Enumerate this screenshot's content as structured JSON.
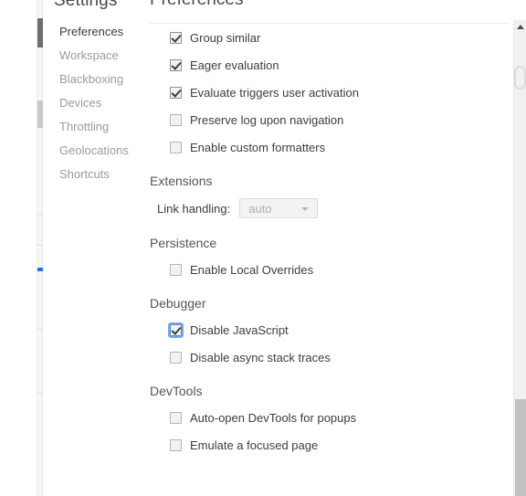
{
  "sidebar": {
    "title": "Settings",
    "items": [
      {
        "label": "Preferences",
        "selected": true
      },
      {
        "label": "Workspace",
        "selected": false
      },
      {
        "label": "Blackboxing",
        "selected": false
      },
      {
        "label": "Devices",
        "selected": false
      },
      {
        "label": "Throttling",
        "selected": false
      },
      {
        "label": "Geolocations",
        "selected": false
      },
      {
        "label": "Shortcuts",
        "selected": false
      }
    ]
  },
  "content": {
    "title": "Preferences",
    "checkboxes_top": [
      {
        "label": "Group similar",
        "checked": true,
        "focused": false
      },
      {
        "label": "Eager evaluation",
        "checked": true,
        "focused": false
      },
      {
        "label": "Evaluate triggers user activation",
        "checked": true,
        "focused": false
      },
      {
        "label": "Preserve log upon navigation",
        "checked": false,
        "focused": false
      },
      {
        "label": "Enable custom formatters",
        "checked": false,
        "focused": false
      }
    ],
    "extensions": {
      "header": "Extensions",
      "link_handling_label": "Link handling:",
      "link_handling_value": "auto",
      "link_handling_disabled": true,
      "dropdown_icon": "chevron-down-icon"
    },
    "persistence": {
      "header": "Persistence",
      "checkboxes": [
        {
          "label": "Enable Local Overrides",
          "checked": false,
          "focused": false
        }
      ]
    },
    "debugger": {
      "header": "Debugger",
      "checkboxes": [
        {
          "label": "Disable JavaScript",
          "checked": true,
          "focused": true
        },
        {
          "label": "Disable async stack traces",
          "checked": false,
          "focused": false
        }
      ]
    },
    "devtools": {
      "header": "DevTools",
      "checkboxes": [
        {
          "label": "Auto-open DevTools for popups",
          "checked": false,
          "focused": false
        },
        {
          "label": "Emulate a focused page",
          "checked": false,
          "focused": false
        }
      ]
    }
  },
  "scrollbars": {
    "right": {
      "up_arrow_icon": "triangle-up-icon",
      "thumb_position": "bottom"
    },
    "left_rail": {
      "marker_color": "#1a73e8",
      "thumb_color": "#c9c9c9"
    }
  },
  "colors": {
    "selected_indicator": "#6e6e6e",
    "focus_ring": "#7aa7e8",
    "text_primary": "#3d3d3d",
    "text_muted": "#9b9b9b",
    "section_header": "#555555",
    "divider": "#ebebeb"
  }
}
